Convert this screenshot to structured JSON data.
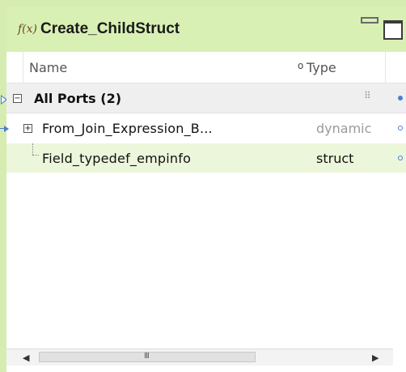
{
  "window": {
    "title": "Create_ChildStruct",
    "icon": "function-icon",
    "icon_text": "f(x)"
  },
  "columns": {
    "name_label": "Name",
    "type_label": "Type",
    "sort_glyph": "o"
  },
  "group": {
    "label": "All Ports (2)",
    "expander": "−",
    "grip": "⠿"
  },
  "ports": [
    {
      "name": "From_Join_Expression_B...",
      "type": "dynamic",
      "expander": "+"
    },
    {
      "name": "Field_typedef_empinfo",
      "type": "struct"
    }
  ],
  "scrollbar": {
    "left_arrow": "◀",
    "right_arrow": "▶",
    "thumb_grip": "III"
  },
  "colors": {
    "title_bg": "#d9f0b4",
    "frame": "#d6ecb0",
    "selected_row": "#ebf6da",
    "port_link": "#4a7fd0"
  }
}
